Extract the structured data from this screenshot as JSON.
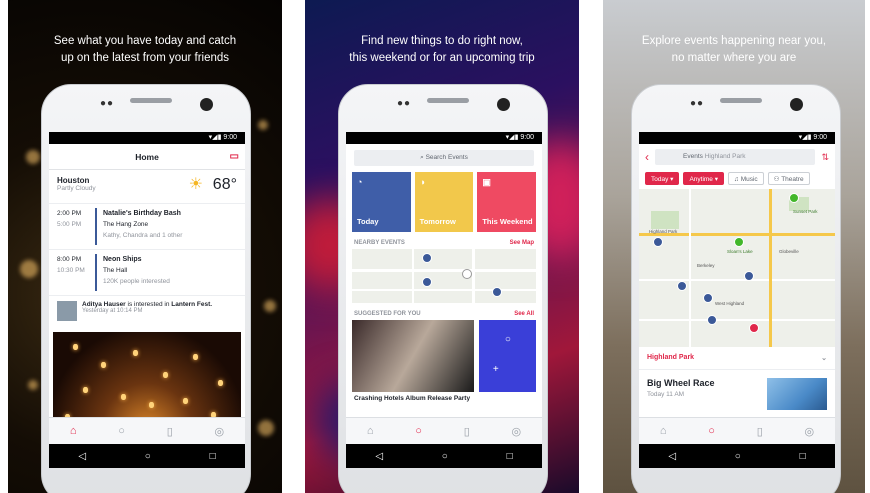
{
  "panels": [
    {
      "caption_line1": "See what you have today and catch",
      "caption_line2": "up on the latest from your friends",
      "status_time": "9:00",
      "header_title": "Home",
      "weather": {
        "city": "Houston",
        "condition": "Partly Cloudy",
        "temp": "68°"
      },
      "events": [
        {
          "start": "2:00 PM",
          "end": "5:00 PM",
          "name": "Natalie's Birthday Bash",
          "venue": "The Hang Zone",
          "social": "Kathy, Chandra and 1 other"
        },
        {
          "start": "8:00 PM",
          "end": "10:30 PM",
          "name": "Neon Ships",
          "venue": "The Hall",
          "social": "120K people interested"
        }
      ],
      "feed": {
        "user": "Aditya Hauser",
        "action": "is interested in",
        "event": "Lantern Fest.",
        "time": "Yesterday at 10:14 PM"
      }
    },
    {
      "caption_line1": "Find new things to do right now,",
      "caption_line2": "this weekend or for an upcoming trip",
      "status_time": "9:00",
      "search_placeholder": "Search Events",
      "tiles": [
        {
          "label": "Today",
          "color": "#3f5ea8"
        },
        {
          "label": "Tomorrow",
          "color": "#f2c84b"
        },
        {
          "label": "This Weekend",
          "color": "#ef4a62"
        }
      ],
      "nearby_label": "NEARBY EVENTS",
      "see_map": "See Map",
      "suggested_label": "SUGGESTED FOR YOU",
      "see_all": "See All",
      "suggested_title": "Crashing Hotels Album Release Party"
    },
    {
      "caption_line1": "Explore events happening near you,",
      "caption_line2": "no matter where you are",
      "status_time": "9:00",
      "search_prefix": "Events",
      "search_location": "Highland Park",
      "chips": [
        "Today",
        "Anytime",
        "Music",
        "Theatre"
      ],
      "map_labels": [
        "Sunset Park",
        "Highland Park",
        "Berkeley",
        "Globeville",
        "Sloan's Lake",
        "West Highland"
      ],
      "location_row": "Highland Park",
      "event_title": "Big Wheel Race",
      "event_time": "Today 11 AM"
    }
  ],
  "colors": {
    "accent": "#e0274a",
    "blue": "#3b5998"
  }
}
